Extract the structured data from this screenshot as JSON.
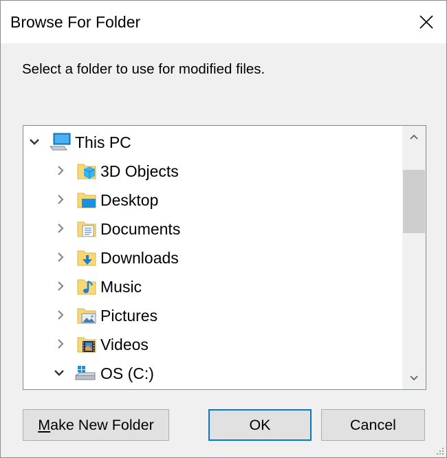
{
  "window": {
    "title": "Browse For Folder",
    "close_icon": "close-icon"
  },
  "prompt": "Select a folder to use for modified files.",
  "tree": {
    "root": {
      "label": "This PC",
      "icon": "computer-icon",
      "expanded": true
    },
    "items": [
      {
        "label": "3D Objects",
        "icon": "3d-objects-folder-icon",
        "expanded": false
      },
      {
        "label": "Desktop",
        "icon": "desktop-folder-icon",
        "expanded": false
      },
      {
        "label": "Documents",
        "icon": "documents-folder-icon",
        "expanded": false
      },
      {
        "label": "Downloads",
        "icon": "downloads-folder-icon",
        "expanded": false
      },
      {
        "label": "Music",
        "icon": "music-folder-icon",
        "expanded": false
      },
      {
        "label": "Pictures",
        "icon": "pictures-folder-icon",
        "expanded": false
      },
      {
        "label": "Videos",
        "icon": "videos-folder-icon",
        "expanded": false
      },
      {
        "label": "OS (C:)",
        "icon": "drive-icon",
        "expanded": true
      }
    ]
  },
  "buttons": {
    "make_new_folder": "Make New Folder",
    "ok": "OK",
    "cancel": "Cancel"
  },
  "colors": {
    "accent": "#0078d7",
    "folder": "#f8d775",
    "dialog_bg": "#f0f0f0"
  }
}
